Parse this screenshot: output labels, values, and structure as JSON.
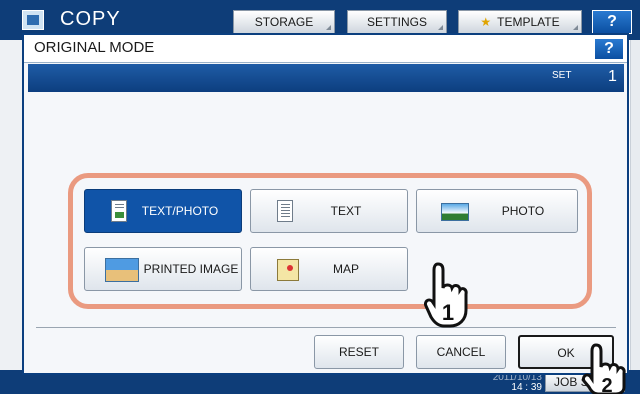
{
  "background": {
    "title": "COPY",
    "tabs": [
      "STORAGE",
      "SETTINGS",
      "TEMPLATE"
    ],
    "help_label": "?",
    "clock_date": "2011/10/13",
    "clock_time": "14 : 39",
    "job_status_label": "JOB S"
  },
  "dialog": {
    "title": "ORIGINAL MODE",
    "help_label": "?",
    "set_label": "SET",
    "set_value": "1"
  },
  "modes": [
    {
      "label": "TEXT/PHOTO",
      "icon": "text-photo-icon",
      "selected": true
    },
    {
      "label": "TEXT",
      "icon": "text-document-icon",
      "selected": false
    },
    {
      "label": "PHOTO",
      "icon": "photo-icon",
      "selected": false
    },
    {
      "label": "PRINTED IMAGE",
      "icon": "printed-image-icon",
      "selected": false
    },
    {
      "label": "MAP",
      "icon": "map-icon",
      "selected": false
    }
  ],
  "footer": {
    "reset_label": "RESET",
    "cancel_label": "CANCEL",
    "ok_label": "OK"
  },
  "callouts": {
    "step1": "1",
    "step2": "2"
  },
  "colors": {
    "header_blue": "#0e3d78",
    "selected_blue": "#1054a8",
    "highlight_outline": "#ea9a80"
  }
}
